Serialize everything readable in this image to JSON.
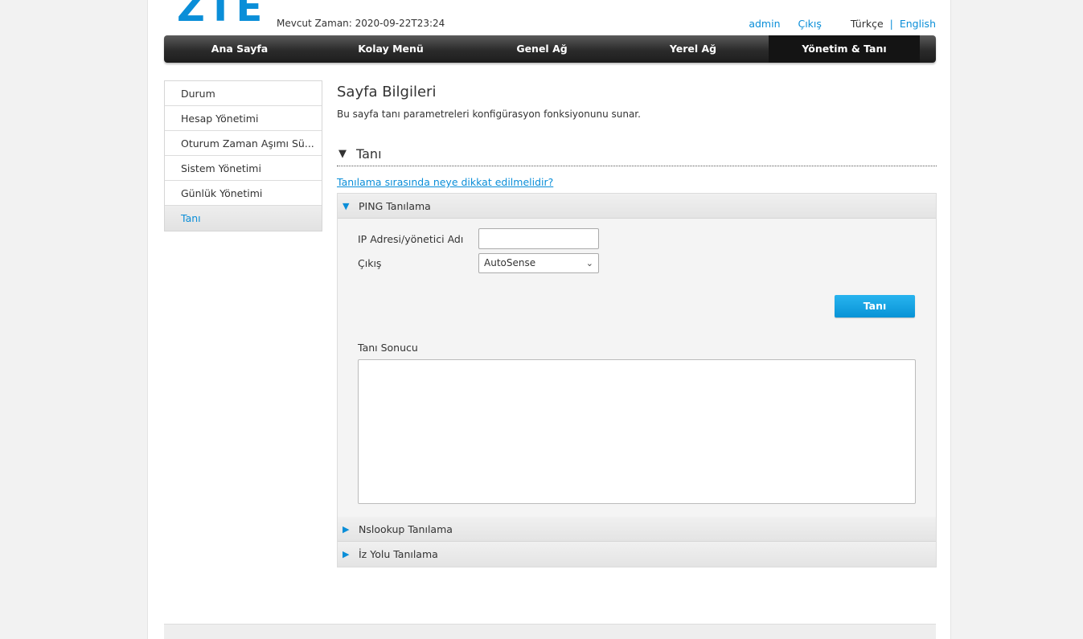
{
  "header": {
    "logo": "ZTE",
    "current_time": "Mevcut Zaman: 2020-09-22T23:24",
    "user": "admin",
    "logout": "Çıkış",
    "lang_current": "Türkçe",
    "lang_separator": "|",
    "lang_other": "English"
  },
  "nav": {
    "items": [
      "Ana Sayfa",
      "Kolay Menü",
      "Genel Ağ",
      "Yerel Ağ",
      "Yönetim & Tanı"
    ],
    "active": "Yönetim & Tanı"
  },
  "sidebar": {
    "items": [
      "Durum",
      "Hesap Yönetimi",
      "Oturum Zaman Aşımı Sü...",
      "Sistem Yönetimi",
      "Günlük Yönetimi",
      "Tanı"
    ],
    "active": "Tanı"
  },
  "main": {
    "title": "Sayfa Bilgileri",
    "description": "Bu sayfa tanı parametreleri konfigürasyon fonksiyonunu sunar.",
    "section_title": "Tanı",
    "help_link": "Tanılama sırasında neye dikkat edilmelidir?",
    "ping": {
      "header": "PING Tanılama",
      "ip_label": "IP Adresi/yönetici Adı",
      "ip_value": "",
      "egress_label": "Çıkış",
      "egress_value": "AutoSense",
      "button": "Tanı",
      "result_label": "Tanı Sonucu",
      "result_value": ""
    },
    "nslookup_header": "Nslookup Tanılama",
    "traceroute_header": "İz Yolu Tanılama"
  },
  "colors": {
    "accent": "#0a8ed8",
    "nav_bg": "#2b2b2b",
    "nav_active": "#141414"
  }
}
